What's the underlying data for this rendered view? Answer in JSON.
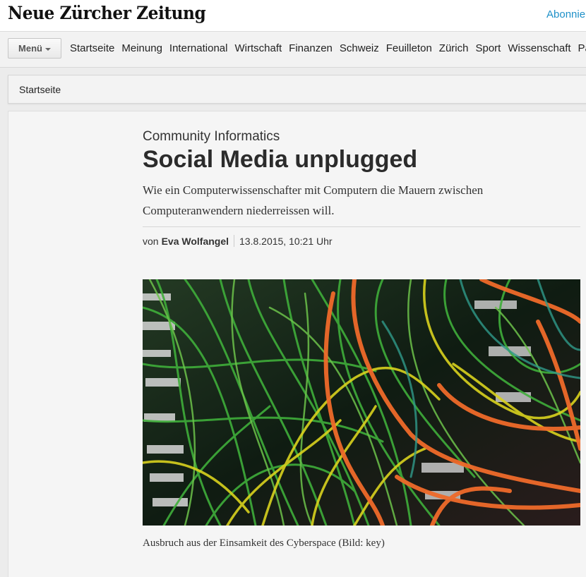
{
  "header": {
    "logo_text": "Neue Zürcher Zeitung",
    "subscribe_label": "Abonnier"
  },
  "nav": {
    "menu_label": "Menü",
    "items": [
      "Startseite",
      "Meinung",
      "International",
      "Wirtschaft",
      "Finanzen",
      "Schweiz",
      "Feuilleton",
      "Zürich",
      "Sport",
      "Wissenschaft",
      "Pan"
    ]
  },
  "breadcrumb": {
    "label": "Startseite"
  },
  "article": {
    "kicker": "Community Informatics",
    "title": "Social Media unplugged",
    "lead": "Wie ein Computerwissenschafter mit Computern die Mauern zwischen Computeranwendern niederreissen will.",
    "byline_prefix": "von",
    "author": "Eva Wolfangel",
    "date": "13.8.2015, 10:21 Uhr",
    "image_caption": "Ausbruch aus der Einsamkeit des Cyberspace (Bild: key)"
  },
  "colors": {
    "link": "#1e90c8",
    "cable_green": "#3fae3a",
    "cable_yellow": "#d9d21e",
    "cable_orange": "#ef6a2a",
    "cable_teal": "#2f9a8a"
  },
  "icons": {
    "menu_caret": "chevron-down-icon"
  }
}
